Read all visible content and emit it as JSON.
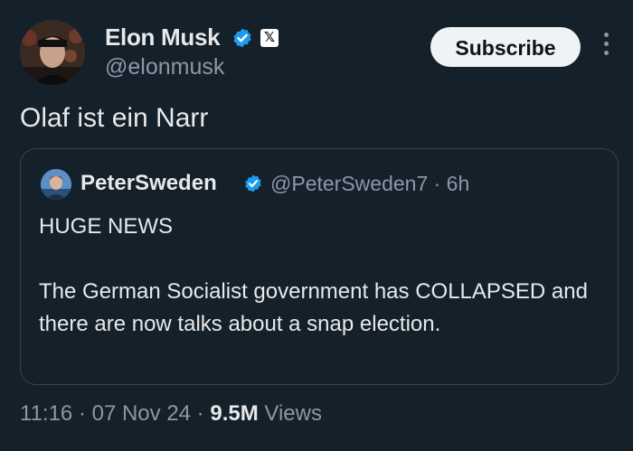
{
  "author": {
    "display_name": "Elon Musk",
    "handle": "@elonmusk",
    "affiliate_badge": "𝕏"
  },
  "actions": {
    "subscribe_label": "Subscribe"
  },
  "tweet": {
    "text": "Olaf ist ein Narr"
  },
  "quoted": {
    "display_name": "PeterSweden",
    "handle_time": "@PeterSweden7 · 6h",
    "line1": "HUGE NEWS",
    "line2": "The German Socialist government has COLLAPSED and there are now talks about a snap election."
  },
  "meta": {
    "time": "11:16",
    "sep1": " · ",
    "date": "07 Nov 24",
    "sep2": " · ",
    "views_count": "9.5M",
    "views_label": " Views"
  },
  "colors": {
    "background": "#14202a",
    "verified": "#1d9bf0",
    "muted": "#8b98a5",
    "text": "#e7e9ea"
  },
  "icons": {
    "verified": "verified-check-icon",
    "more": "more-vertical-icon"
  }
}
